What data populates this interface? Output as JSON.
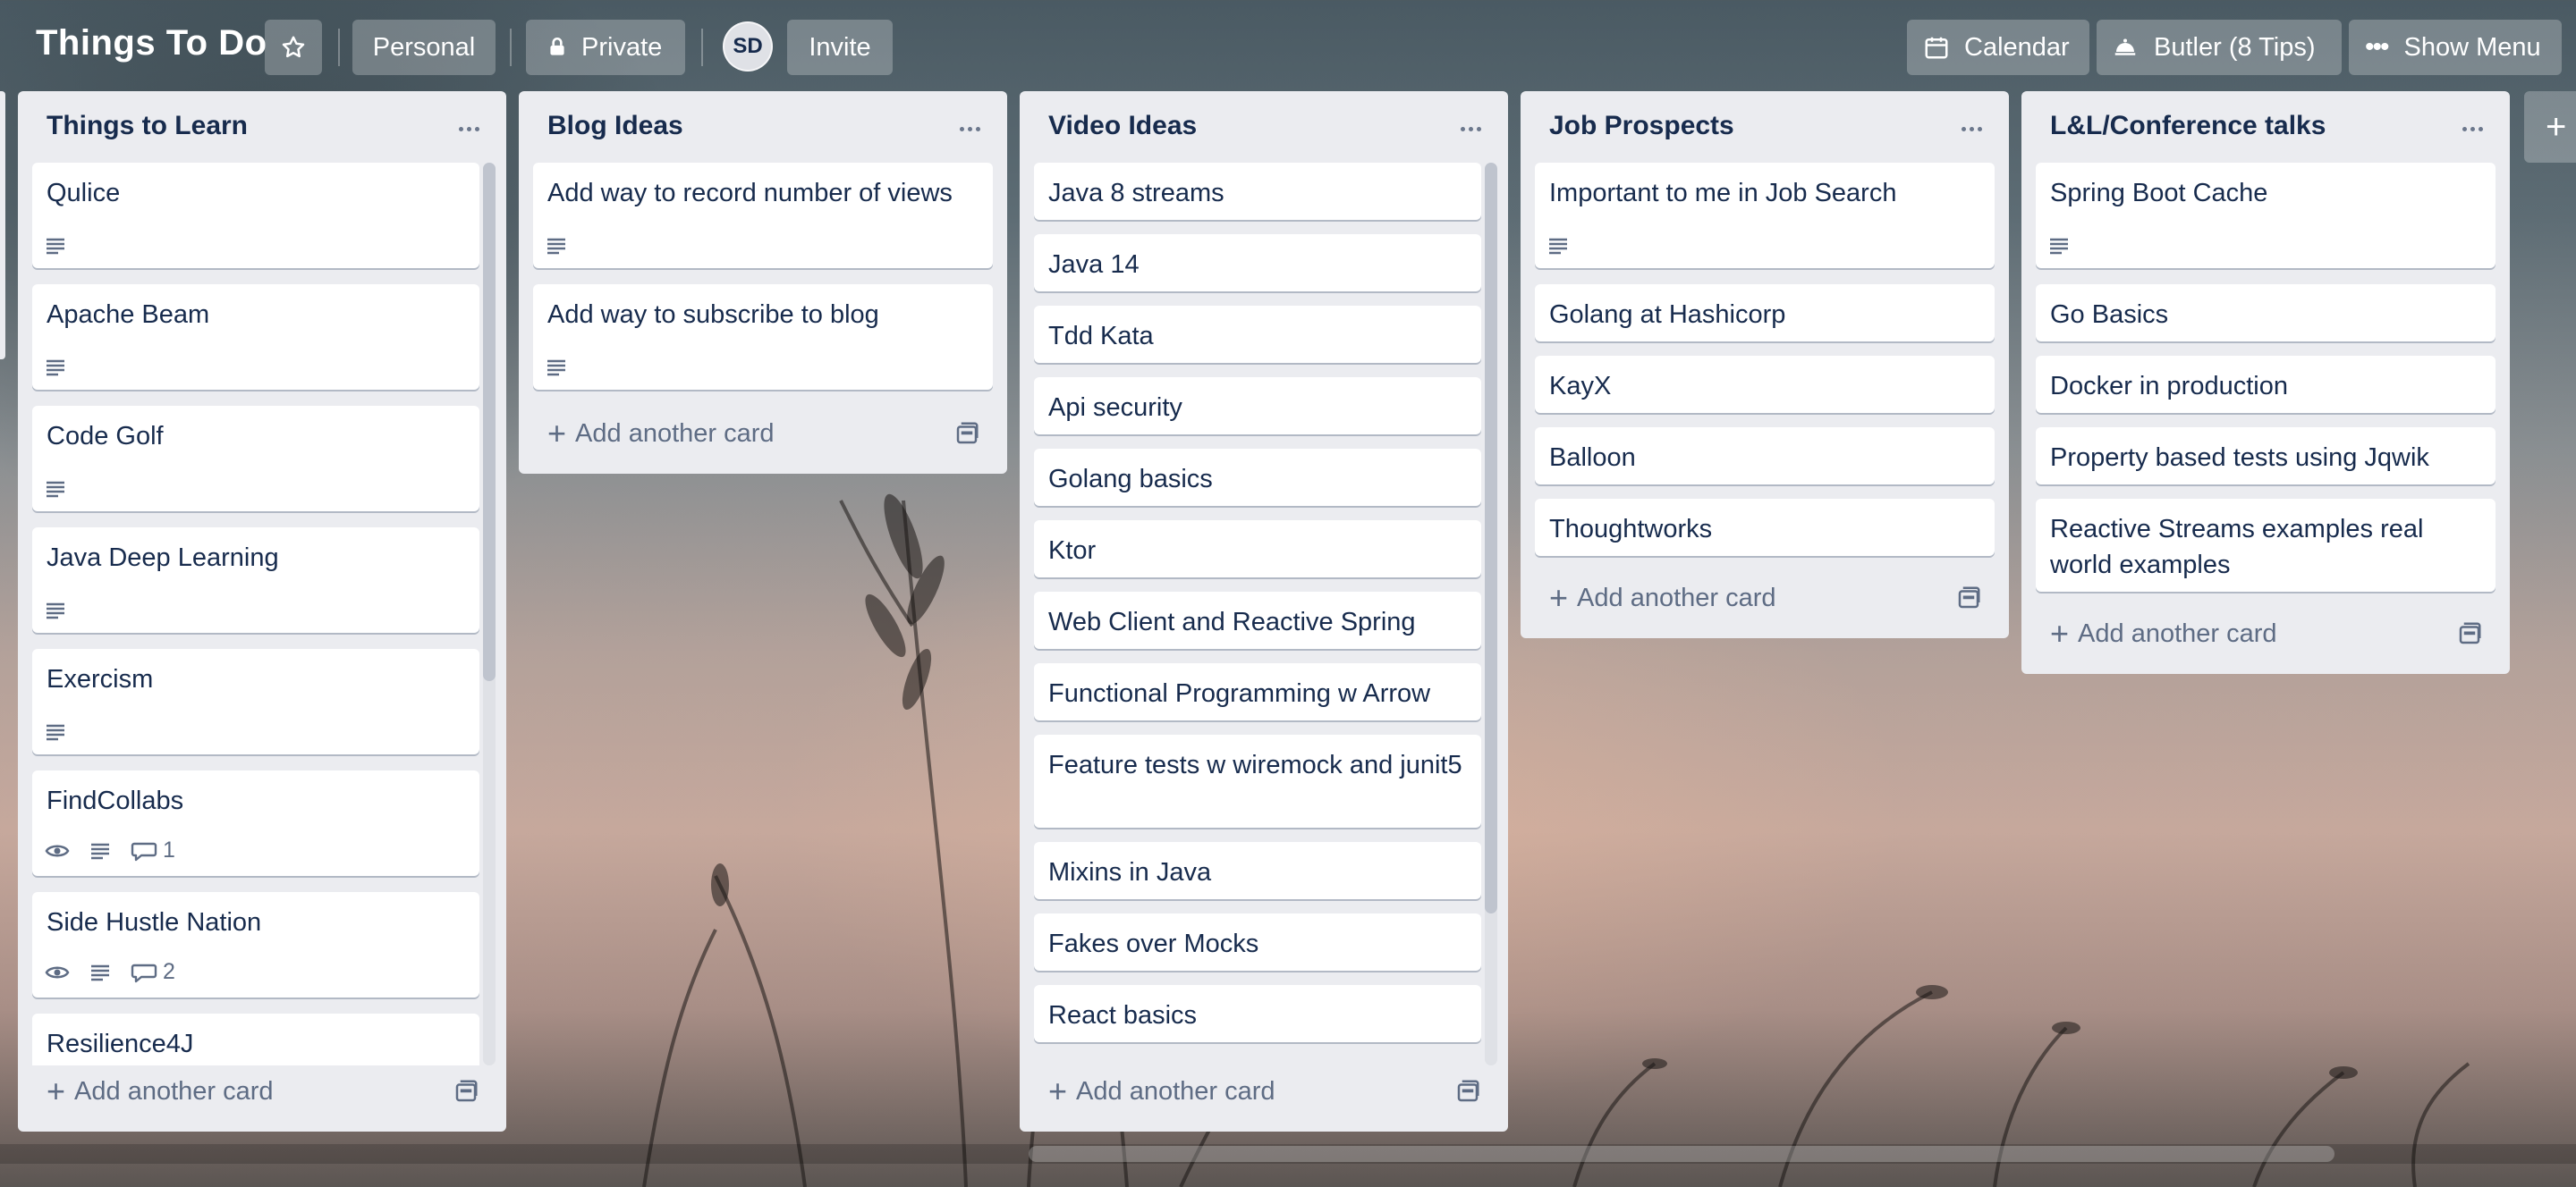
{
  "header": {
    "board_title": "Things To Do",
    "personal_label": "Personal",
    "private_label": "Private",
    "avatar_initials": "SD",
    "invite_label": "Invite",
    "calendar_label": "Calendar",
    "butler_label": "Butler (8 Tips)",
    "show_menu_label": "Show Menu"
  },
  "add_card_label": "Add another card",
  "lists": [
    {
      "title": "Things to Learn",
      "cards": [
        {
          "title": "Qulice",
          "badges": [
            "description"
          ]
        },
        {
          "title": "Apache Beam",
          "badges": [
            "description"
          ]
        },
        {
          "title": "Code Golf",
          "badges": [
            "description"
          ]
        },
        {
          "title": "Java Deep Learning",
          "badges": [
            "description"
          ]
        },
        {
          "title": "Exercism",
          "badges": [
            "description"
          ]
        },
        {
          "title": "FindCollabs",
          "badges": [
            "watch",
            "description",
            "comments"
          ],
          "comments": "1"
        },
        {
          "title": "Side Hustle Nation",
          "badges": [
            "watch",
            "description",
            "comments"
          ],
          "comments": "2"
        },
        {
          "title": "Resilience4J",
          "badges": []
        }
      ]
    },
    {
      "title": "Blog Ideas",
      "cards": [
        {
          "title": "Add way to record number of views",
          "badges": [
            "description"
          ]
        },
        {
          "title": "Add way to subscribe to blog",
          "badges": [
            "description"
          ]
        }
      ]
    },
    {
      "title": "Video Ideas",
      "cards": [
        {
          "title": "Java 8 streams"
        },
        {
          "title": "Java 14"
        },
        {
          "title": "Tdd Kata"
        },
        {
          "title": "Api security"
        },
        {
          "title": "Golang basics"
        },
        {
          "title": "Ktor"
        },
        {
          "title": "Web Client and Reactive Spring"
        },
        {
          "title": "Functional Programming w Arrow"
        },
        {
          "title": "Feature tests w wiremock and junit5"
        },
        {
          "title": "Mixins in Java"
        },
        {
          "title": "Fakes over Mocks"
        },
        {
          "title": "React basics"
        }
      ]
    },
    {
      "title": "Job Prospects",
      "cards": [
        {
          "title": "Important to me in Job Search",
          "badges": [
            "description"
          ]
        },
        {
          "title": "Golang at Hashicorp"
        },
        {
          "title": "KayX"
        },
        {
          "title": "Balloon"
        },
        {
          "title": "Thoughtworks"
        }
      ]
    },
    {
      "title": "L&L/Conference talks",
      "cards": [
        {
          "title": "Spring Boot Cache",
          "badges": [
            "description"
          ]
        },
        {
          "title": "Go Basics"
        },
        {
          "title": "Docker in production"
        },
        {
          "title": "Property based tests using Jqwik"
        },
        {
          "title": "Reactive Streams examples real world examples"
        }
      ]
    }
  ]
}
